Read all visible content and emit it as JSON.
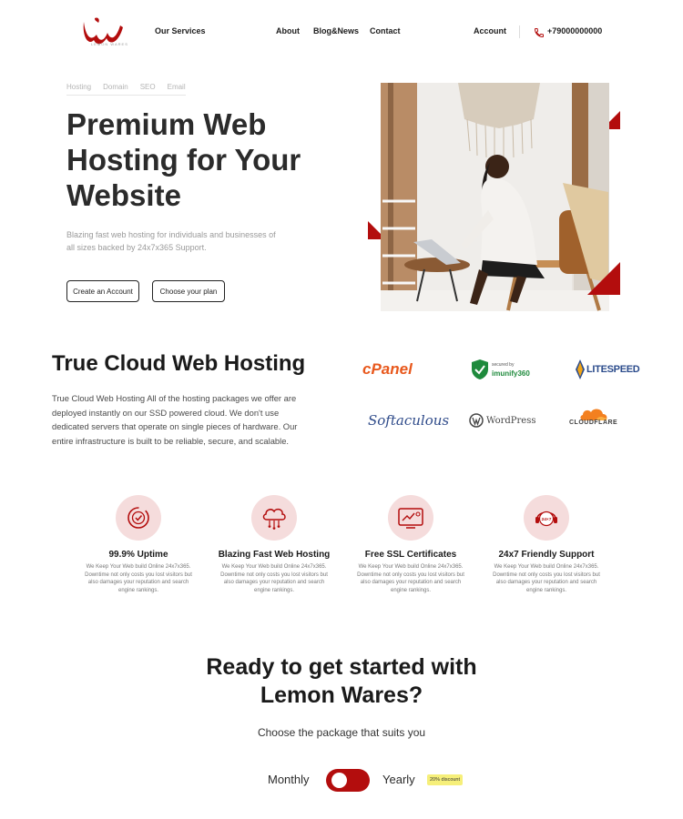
{
  "header": {
    "logo_text": "LEMON WARES",
    "nav_left": [
      "Our Services"
    ],
    "nav_center": [
      "About",
      "Blog&News",
      "Contact"
    ],
    "account": "Account",
    "phone": "+79000000000"
  },
  "hero": {
    "tabs": [
      "Hosting",
      "Domain",
      "SEO",
      "Email"
    ],
    "title": "Premium Web Hosting for Your Website",
    "subtitle": "Blazing fast web hosting for individuals and businesses of all sizes backed by 24x7x365 Support.",
    "btn_create": "Create an Account",
    "btn_plan": "Choose your plan"
  },
  "cloud": {
    "title": "True Cloud Web Hosting",
    "body": "True Cloud Web Hosting All of the hosting packages we offer are deployed instantly on our SSD powered cloud. We don't use dedicated servers that operate on single pieces of hardware. Our entire infrastructure is built to be reliable, secure, and scalable.",
    "partners": {
      "cpanel": "cPanel",
      "imunify_small": "secured by",
      "imunify": "imunify360",
      "litespeed": "LITESPEED",
      "softaculous": "Softaculous",
      "wordpress": "WordPress",
      "cloudflare": "CLOUDFLARE"
    }
  },
  "features": [
    {
      "title": "99.9% Uptime",
      "desc": "We Keep Your Web build Online 24x7x365. Downtime not only costs you lost visitors but also damages your reputation and search engine rankings."
    },
    {
      "title": "Blazing Fast Web Hosting",
      "desc": "We Keep Your Web build Online 24x7x365. Downtime not only costs you lost visitors but also damages your reputation and search engine rankings."
    },
    {
      "title": "Free SSL Certificates",
      "desc": "We Keep Your Web build Online 24x7x365. Downtime not only costs you lost visitors but also damages your reputation and search engine rankings."
    },
    {
      "title": "24x7 Friendly Support",
      "desc": "We Keep Your Web build Online 24x7x365. Downtime not only costs you lost visitors but also damages your reputation and search engine rankings."
    }
  ],
  "support_icon_text": "24×7",
  "pricing": {
    "title_line1": "Ready to get started with",
    "title_line2": "Lemon Wares?",
    "subtitle": "Choose the package that suits you",
    "monthly": "Monthly",
    "yearly": "Yearly",
    "discount": "20% discount"
  },
  "colors": {
    "brand_red": "#b30d0d",
    "soft_pink": "#f5dcdc",
    "discount_yellow": "#f6ef7a"
  }
}
